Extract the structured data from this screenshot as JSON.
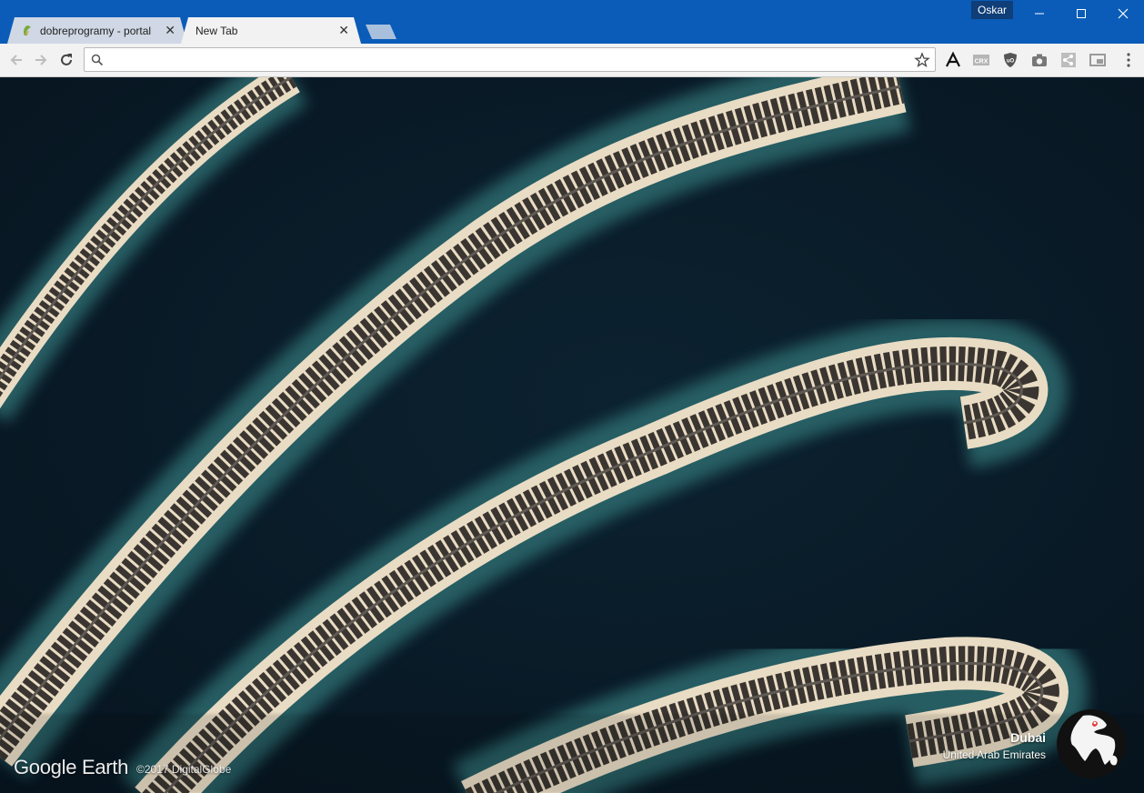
{
  "browser": {
    "profile_name": "Oskar",
    "tabs": [
      {
        "title": "dobreprogramy - portal",
        "active": false,
        "favicon": "leaf-favicon"
      },
      {
        "title": "New Tab",
        "active": true
      }
    ],
    "window_controls": [
      "minimize-icon",
      "maximize-icon",
      "close-icon"
    ],
    "accent_color": "#0a5cb8"
  },
  "toolbar": {
    "nav_icons": [
      "back-icon",
      "forward-icon",
      "reload-icon"
    ],
    "omnibox": {
      "value": "",
      "placeholder": ""
    },
    "extensions": [
      {
        "name": "font-a-icon"
      },
      {
        "name": "crx-icon",
        "label": "CRX"
      },
      {
        "name": "ublock-shield-icon",
        "label": "uO"
      },
      {
        "name": "camera-icon"
      },
      {
        "name": "share-icon"
      },
      {
        "name": "cast-icon"
      },
      {
        "name": "menu-kebab-icon"
      }
    ]
  },
  "earth_view": {
    "brand": "Google Earth",
    "copyright": "©2017 DigitalGlobe",
    "location": {
      "city": "Dubai",
      "country": "United Arab Emirates"
    },
    "colors": {
      "water": "#0b1f2c",
      "shallow": "#2f6e72",
      "sand": "#e9dcc4",
      "houses": "#3a3530"
    }
  }
}
